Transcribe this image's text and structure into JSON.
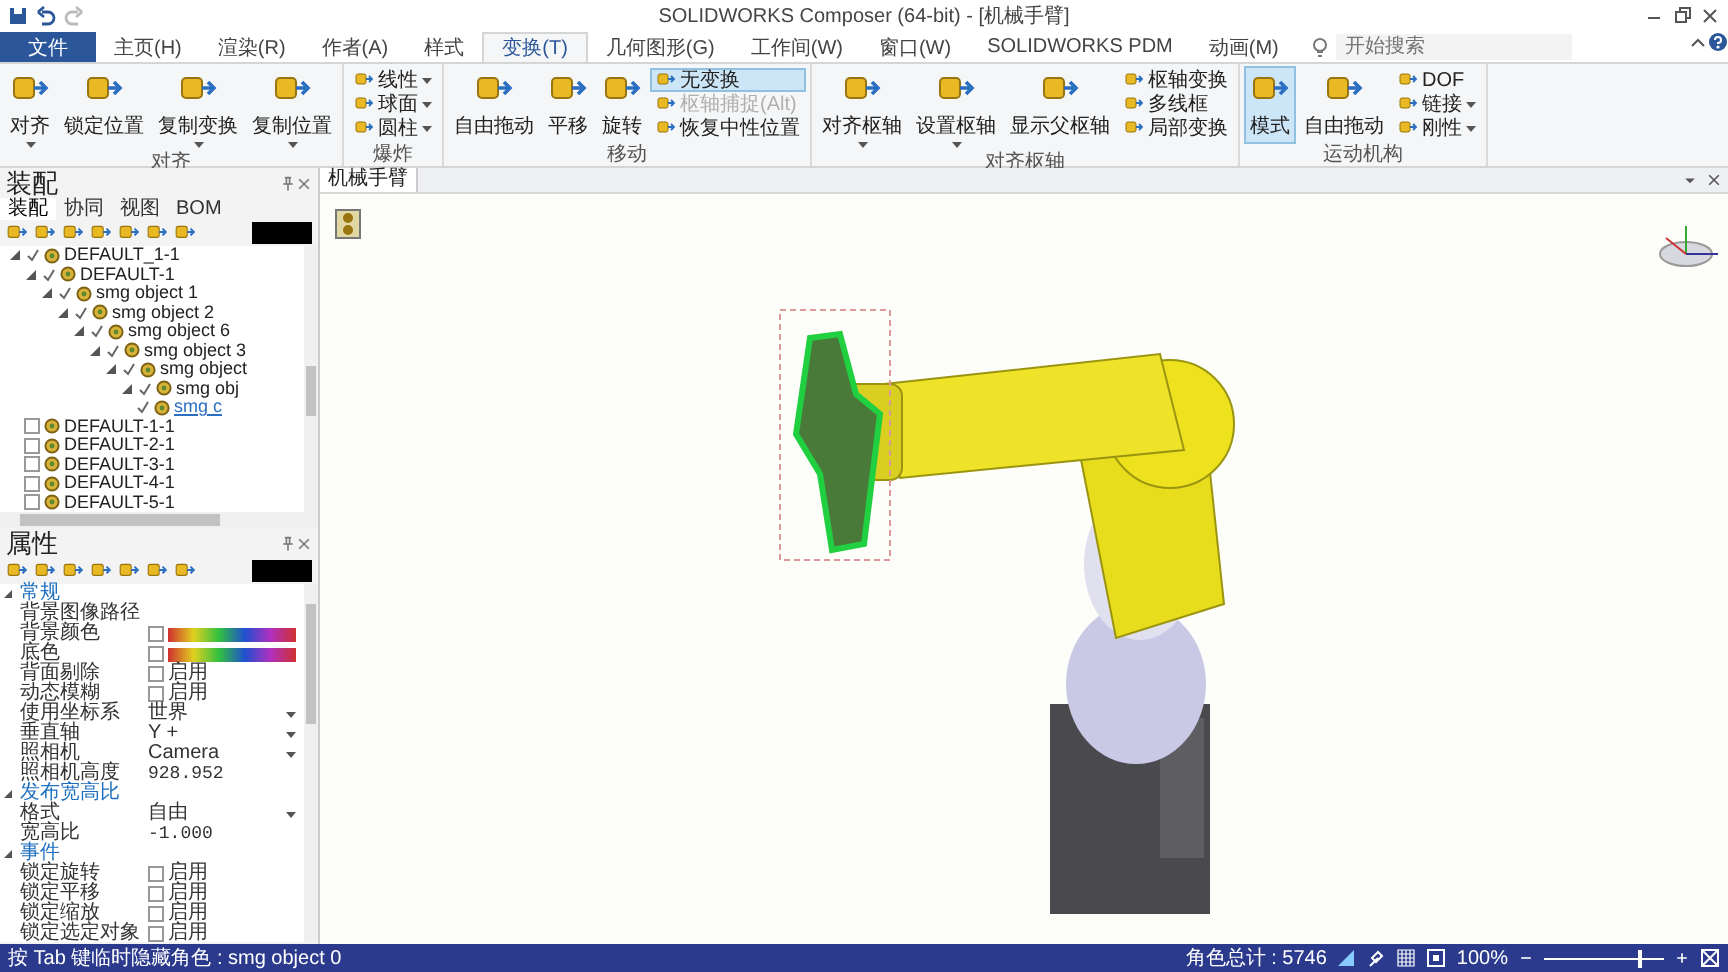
{
  "window": {
    "title": "SOLIDWORKS Composer (64-bit) - [机械手臂]"
  },
  "tabs": [
    {
      "label": "文件",
      "kind": "file",
      "selected": false
    },
    {
      "label": "主页(H)",
      "kind": "tab",
      "selected": false
    },
    {
      "label": "渲染(R)",
      "kind": "tab",
      "selected": false
    },
    {
      "label": "作者(A)",
      "kind": "tab",
      "selected": false
    },
    {
      "label": "样式",
      "kind": "tab",
      "selected": false
    },
    {
      "label": "变换(T)",
      "kind": "tab",
      "selected": true
    },
    {
      "label": "几何图形(G)",
      "kind": "tab",
      "selected": false
    },
    {
      "label": "工作间(W)",
      "kind": "tab",
      "selected": false
    },
    {
      "label": "窗口(W)",
      "kind": "tab",
      "selected": false
    },
    {
      "label": "SOLIDWORKS PDM",
      "kind": "tab",
      "selected": false
    },
    {
      "label": "动画(M)",
      "kind": "tab",
      "selected": false
    }
  ],
  "search": {
    "placeholder": "开始搜索"
  },
  "ribbon": [
    {
      "label": "对齐",
      "buttons": [
        {
          "label": "对齐",
          "kind": "large",
          "dropdown": true,
          "selected": false,
          "disabled": false
        },
        {
          "label": "锁定位置",
          "kind": "large",
          "dropdown": false,
          "selected": false,
          "disabled": false
        },
        {
          "label": "复制变换",
          "kind": "large",
          "dropdown": true,
          "selected": false,
          "disabled": false
        },
        {
          "label": "复制位置",
          "kind": "large",
          "dropdown": true,
          "selected": false,
          "disabled": false
        }
      ]
    },
    {
      "label": "爆炸",
      "buttons": [
        {
          "label": "线性",
          "kind": "small",
          "dropdown": true,
          "selected": false,
          "disabled": false
        },
        {
          "label": "球面",
          "kind": "small",
          "dropdown": true,
          "selected": false,
          "disabled": false
        },
        {
          "label": "圆柱",
          "kind": "small",
          "dropdown": true,
          "selected": false,
          "disabled": false
        }
      ]
    },
    {
      "label": "移动",
      "buttons": [
        {
          "label": "自由拖动",
          "kind": "large",
          "dropdown": false,
          "selected": false,
          "disabled": false
        },
        {
          "label": "平移",
          "kind": "large",
          "dropdown": false,
          "selected": false,
          "disabled": false
        },
        {
          "label": "旋转",
          "kind": "large",
          "dropdown": false,
          "selected": false,
          "disabled": false
        },
        {
          "label": "无变换",
          "kind": "small",
          "dropdown": false,
          "selected": true,
          "disabled": false
        },
        {
          "label": "枢轴捕捉(Alt)",
          "kind": "small",
          "dropdown": false,
          "selected": false,
          "disabled": true
        },
        {
          "label": "恢复中性位置",
          "kind": "small",
          "dropdown": false,
          "selected": false,
          "disabled": false
        }
      ]
    },
    {
      "label": "对齐枢轴",
      "buttons": [
        {
          "label": "对齐枢轴",
          "kind": "large",
          "dropdown": true,
          "selected": false,
          "disabled": false
        },
        {
          "label": "设置枢轴",
          "kind": "large",
          "dropdown": true,
          "selected": false,
          "disabled": false
        },
        {
          "label": "显示父枢轴",
          "kind": "large",
          "dropdown": false,
          "selected": false,
          "disabled": false
        },
        {
          "label": "枢轴变换",
          "kind": "small",
          "dropdown": false,
          "selected": false,
          "disabled": false
        },
        {
          "label": "多线框",
          "kind": "small",
          "dropdown": false,
          "selected": false,
          "disabled": false
        },
        {
          "label": "局部变换",
          "kind": "small",
          "dropdown": false,
          "selected": false,
          "disabled": false
        }
      ]
    },
    {
      "label": "运动机构",
      "buttons": [
        {
          "label": "模式",
          "kind": "large",
          "dropdown": false,
          "selected": true,
          "disabled": false
        },
        {
          "label": "自由拖动",
          "kind": "large",
          "dropdown": false,
          "selected": false,
          "disabled": false
        },
        {
          "label": "DOF",
          "kind": "small",
          "dropdown": false,
          "selected": false,
          "disabled": false
        },
        {
          "label": "链接",
          "kind": "small",
          "dropdown": true,
          "selected": false,
          "disabled": false
        },
        {
          "label": "刚性",
          "kind": "small",
          "dropdown": true,
          "selected": false,
          "disabled": false
        }
      ]
    }
  ],
  "assembly": {
    "title": "装配",
    "tabs": [
      {
        "label": "装配",
        "selected": true
      },
      {
        "label": "协同",
        "selected": false
      },
      {
        "label": "视图",
        "selected": false
      },
      {
        "label": "BOM",
        "selected": false
      }
    ],
    "tree": [
      {
        "label": "DEFAULT_1-1",
        "checked": true,
        "expanded": true,
        "selected": false,
        "children": [
          {
            "label": "DEFAULT-1",
            "checked": true,
            "expanded": true,
            "selected": false,
            "children": [
              {
                "label": "smg object 1",
                "checked": true,
                "expanded": true,
                "selected": false,
                "children": [
                  {
                    "label": "smg object 2",
                    "checked": true,
                    "expanded": true,
                    "selected": false,
                    "children": [
                      {
                        "label": "smg object 6",
                        "checked": true,
                        "expanded": true,
                        "selected": false,
                        "children": [
                          {
                            "label": "smg object 3",
                            "checked": true,
                            "expanded": true,
                            "selected": false,
                            "children": [
                              {
                                "label": "smg object",
                                "checked": true,
                                "expanded": true,
                                "selected": false,
                                "children": [
                                  {
                                    "label": "smg obj",
                                    "checked": true,
                                    "expanded": true,
                                    "selected": false,
                                    "children": [
                                      {
                                        "label": "smg c",
                                        "checked": true,
                                        "selected": true
                                      }
                                    ]
                                  }
                                ]
                              }
                            ]
                          }
                        ]
                      }
                    ]
                  }
                ]
              }
            ]
          },
          {
            "label": "DEFAULT-1-1",
            "checked": false,
            "selected": false
          },
          {
            "label": "DEFAULT-2-1",
            "checked": false,
            "selected": false
          },
          {
            "label": "DEFAULT-3-1",
            "checked": false,
            "selected": false
          },
          {
            "label": "DEFAULT-4-1",
            "checked": false,
            "selected": false
          },
          {
            "label": "DEFAULT-5-1",
            "checked": false,
            "selected": false
          }
        ]
      }
    ]
  },
  "properties": {
    "title": "属性",
    "sections": [
      {
        "label": "常规",
        "expanded": true,
        "rows": [
          {
            "name": "背景图像路径",
            "kind": "text"
          },
          {
            "name": "背景颜色",
            "kind": "gradient"
          },
          {
            "name": "底色",
            "kind": "gradient"
          },
          {
            "name": "背面剔除",
            "kind": "checkbox",
            "value": "启用",
            "checked": false
          },
          {
            "name": "动态模糊",
            "kind": "checkbox",
            "value": "启用",
            "checked": false
          },
          {
            "name": "使用坐标系",
            "kind": "dropdown",
            "value": "世界"
          },
          {
            "name": "垂直轴",
            "kind": "dropdown",
            "value": "Y +"
          },
          {
            "name": "照相机",
            "kind": "dropdown",
            "value": "Camera"
          },
          {
            "name": "照相机高度",
            "kind": "text",
            "value": "928.952"
          }
        ]
      },
      {
        "label": "发布宽高比",
        "expanded": true,
        "rows": [
          {
            "name": "格式",
            "kind": "dropdown",
            "value": "自由"
          },
          {
            "name": "宽高比",
            "kind": "text",
            "value": "-1.000"
          }
        ]
      },
      {
        "label": "事件",
        "expanded": true,
        "rows": [
          {
            "name": "锁定旋转",
            "kind": "checkbox",
            "value": "启用",
            "checked": false
          },
          {
            "name": "锁定平移",
            "kind": "checkbox",
            "value": "启用",
            "checked": false
          },
          {
            "name": "锁定缩放",
            "kind": "checkbox",
            "value": "启用",
            "checked": false
          },
          {
            "name": "锁定选定对象",
            "kind": "checkbox",
            "value": "启用",
            "checked": false
          }
        ]
      }
    ]
  },
  "viewport": {
    "tab": "机械手臂"
  },
  "status_bar": {
    "message": "按 Tab 键临时隐藏角色 : smg object 0",
    "actor_count": "角色总计 : 5746",
    "zoom": "100%",
    "zoom_slider": {
      "level": 0.8
    }
  }
}
